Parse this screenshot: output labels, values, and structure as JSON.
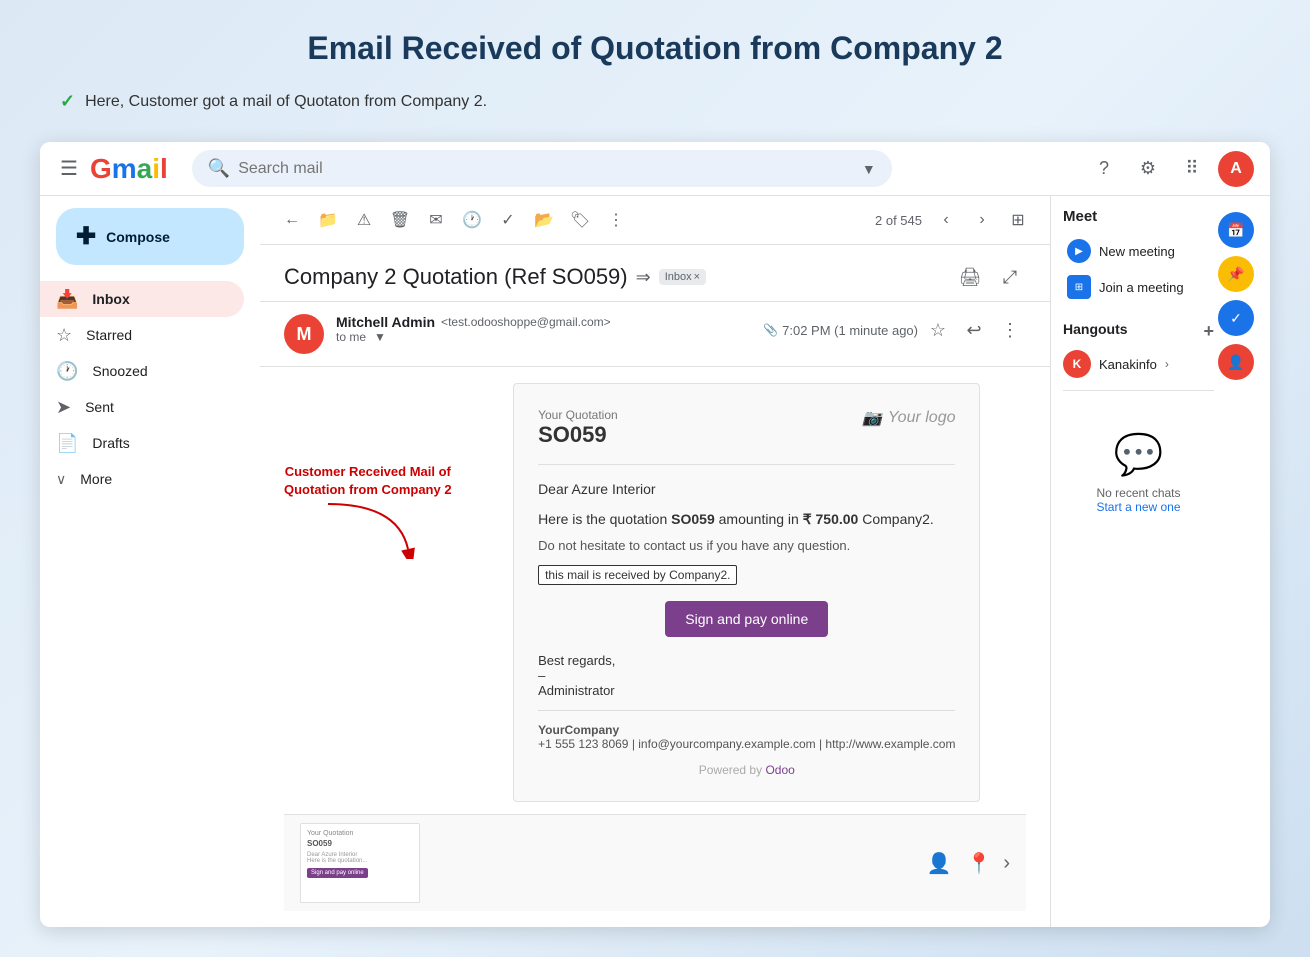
{
  "page": {
    "title": "Email Received of Quotation from Company 2",
    "subtitle": "Here, Customer got a mail of Quotaton from Company 2."
  },
  "gmail": {
    "search_placeholder": "Search mail",
    "compose_label": "Compose",
    "sidebar": {
      "items": [
        {
          "id": "inbox",
          "label": "Inbox",
          "icon": "📥",
          "active": true
        },
        {
          "id": "starred",
          "label": "Starred",
          "icon": "☆"
        },
        {
          "id": "snoozed",
          "label": "Snoozed",
          "icon": "🕐"
        },
        {
          "id": "sent",
          "label": "Sent",
          "icon": "➤"
        },
        {
          "id": "drafts",
          "label": "Drafts",
          "icon": "📄"
        },
        {
          "id": "more",
          "label": "More",
          "icon": "∨"
        }
      ]
    },
    "email": {
      "subject": "Company 2 Quotation (Ref SO059)",
      "inbox_badge": "Inbox",
      "sender_name": "Mitchell Admin",
      "sender_email": "test.odooshoppe@gmail.com",
      "time": "7:02 PM (1 minute ago)",
      "to": "to me",
      "pagination": "2 of 545"
    },
    "quotation": {
      "label": "Your Quotation",
      "number": "SO059",
      "logo_text": "Your logo",
      "greeting": "Dear Azure Interior",
      "body_1": "Here is the quotation",
      "body_bold": "SO059",
      "body_2": "amounting in",
      "amount": "₹ 750.00",
      "company": "Company2.",
      "no_hesitate": "Do not hesitate to contact us if you have any question.",
      "received_text": "this mail is received by Company2.",
      "sign_pay": "Sign and pay online",
      "regards": "Best regards,",
      "dash": "–",
      "admin": "Administrator",
      "footer_company": "YourCompany",
      "footer_details": "+1 555 123 8069 | info@yourcompany.example.com | http://www.example.com",
      "powered_by": "Powered by",
      "odoo_link": "Odoo"
    },
    "annotation": {
      "text": "Customer Received Mail of\nQuotation from Company 2"
    },
    "meet": {
      "title": "Meet",
      "new_meeting": "New meeting",
      "join_meeting": "Join a meeting",
      "hangouts_title": "Hangouts",
      "hangout_user": "Kanakinfo",
      "no_recent": "No recent chats",
      "start_new": "Start a new one"
    }
  }
}
